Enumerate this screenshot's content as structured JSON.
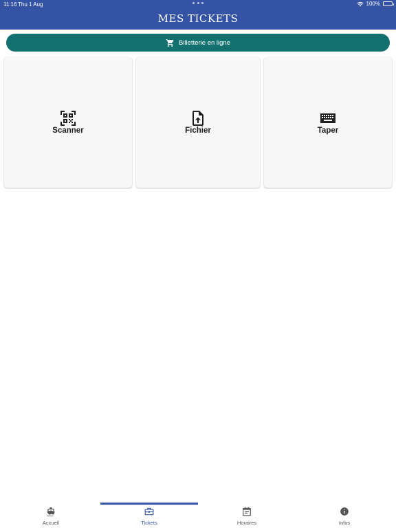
{
  "status": {
    "time": "11:16",
    "date": "Thu 1 Aug",
    "battery": "100%"
  },
  "header": {
    "title": "MES TICKETS",
    "background_color": "#3453a4"
  },
  "online_button": {
    "label": "Billetterie en ligne",
    "icon": "shopping-cart-icon",
    "color": "#12716f"
  },
  "cards": [
    {
      "label": "Scanner",
      "icon": "qr-code-scan-icon"
    },
    {
      "label": "Fichier",
      "icon": "file-upload-icon"
    },
    {
      "label": "Taper",
      "icon": "keyboard-icon"
    }
  ],
  "bottom_nav": {
    "active": "Tickets",
    "accent_color": "#3453a4",
    "items": [
      {
        "label": "Accueil",
        "icon": "boat-icon"
      },
      {
        "label": "Tickets",
        "icon": "briefcase-icon"
      },
      {
        "label": "Horaires",
        "icon": "calendar-icon"
      },
      {
        "label": "Infos",
        "icon": "info-icon"
      }
    ]
  }
}
